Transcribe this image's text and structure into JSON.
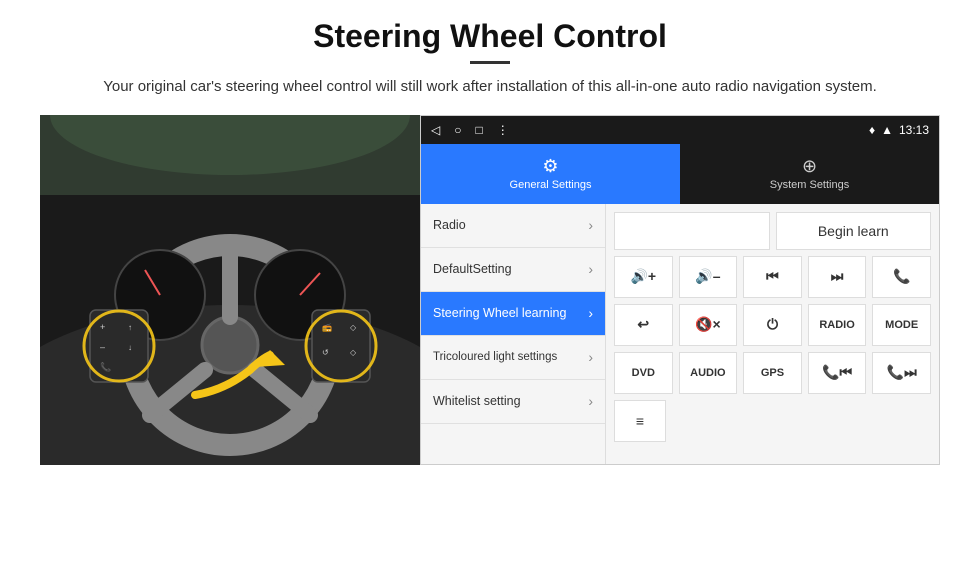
{
  "header": {
    "title": "Steering Wheel Control",
    "subtitle": "Your original car's steering wheel control will still work after installation of this all-in-one auto radio navigation system."
  },
  "statusBar": {
    "back": "◁",
    "circle": "○",
    "square": "□",
    "menu": "⋮",
    "location": "♦",
    "wifi": "▲",
    "time": "13:13"
  },
  "tabs": [
    {
      "id": "general",
      "label": "General Settings",
      "icon": "⚙",
      "active": true
    },
    {
      "id": "system",
      "label": "System Settings",
      "icon": "⊕",
      "active": false
    }
  ],
  "menuItems": [
    {
      "label": "Radio",
      "active": false
    },
    {
      "label": "DefaultSetting",
      "active": false
    },
    {
      "label": "Steering Wheel learning",
      "active": true
    },
    {
      "label": "Tricoloured light settings",
      "active": false
    },
    {
      "label": "Whitelist setting",
      "active": false
    }
  ],
  "controls": {
    "beginLearnLabel": "Begin learn",
    "row2": [
      "🔊+",
      "🔊–",
      "⏮",
      "⏭",
      "📞"
    ],
    "row3": [
      "↩",
      "🔇x",
      "⏻",
      "RADIO",
      "MODE"
    ],
    "row4": [
      "DVD",
      "AUDIO",
      "GPS",
      "📞⏮",
      "📞⏭"
    ]
  }
}
